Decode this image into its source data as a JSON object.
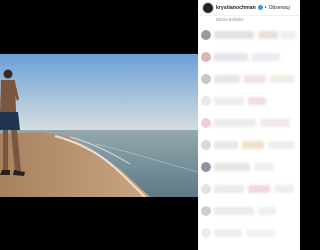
{
  "post": {
    "username": "krystianochman",
    "separator": "•",
    "follow_label": "Obserwuj",
    "location": "Mezia ballioke"
  },
  "colors": {
    "accent": "#3897f0",
    "sky_top": "#6f9fd3",
    "sea": "#6e8a93",
    "sand": "#b58c6a"
  },
  "icons": [
    "verified-badge-icon"
  ]
}
